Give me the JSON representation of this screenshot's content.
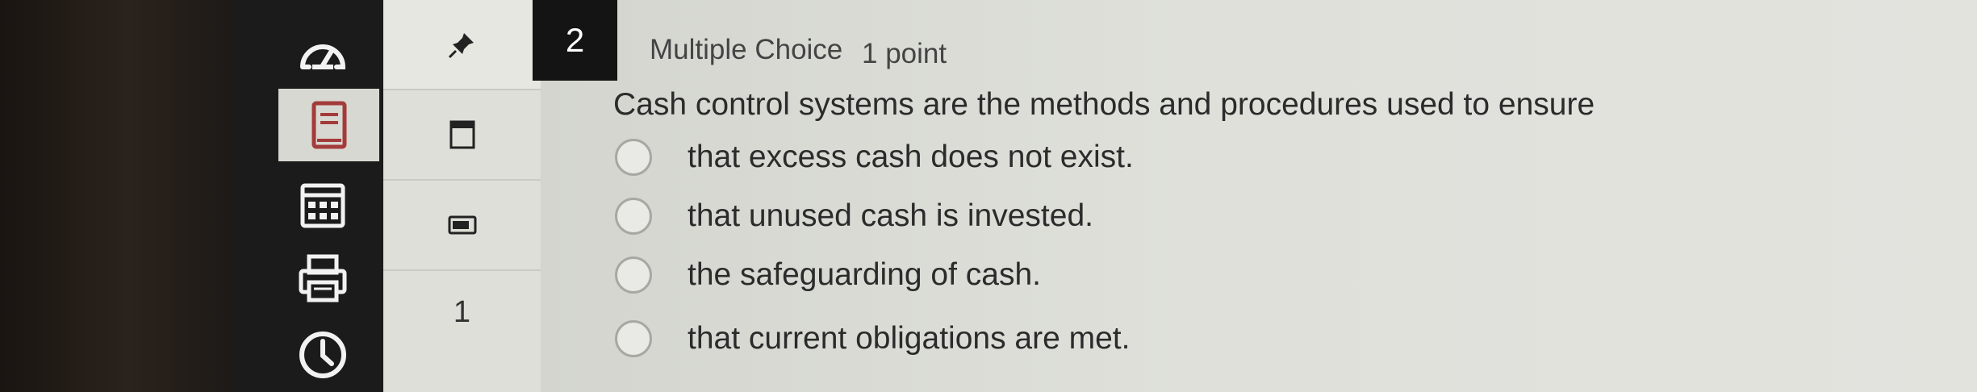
{
  "rail": {
    "items": [
      {
        "name": "dashboard"
      },
      {
        "name": "book"
      },
      {
        "name": "calendar"
      },
      {
        "name": "printer"
      },
      {
        "name": "clock"
      }
    ]
  },
  "panel": {
    "question_count": "1"
  },
  "question": {
    "number": "2",
    "type": "Multiple Choice",
    "points": "1 point",
    "prompt": "Cash control systems are the methods and procedures used to ensure",
    "choices": [
      "that excess cash does not exist.",
      "that unused cash is invested.",
      "the safeguarding of cash.",
      "that current obligations are met."
    ]
  }
}
